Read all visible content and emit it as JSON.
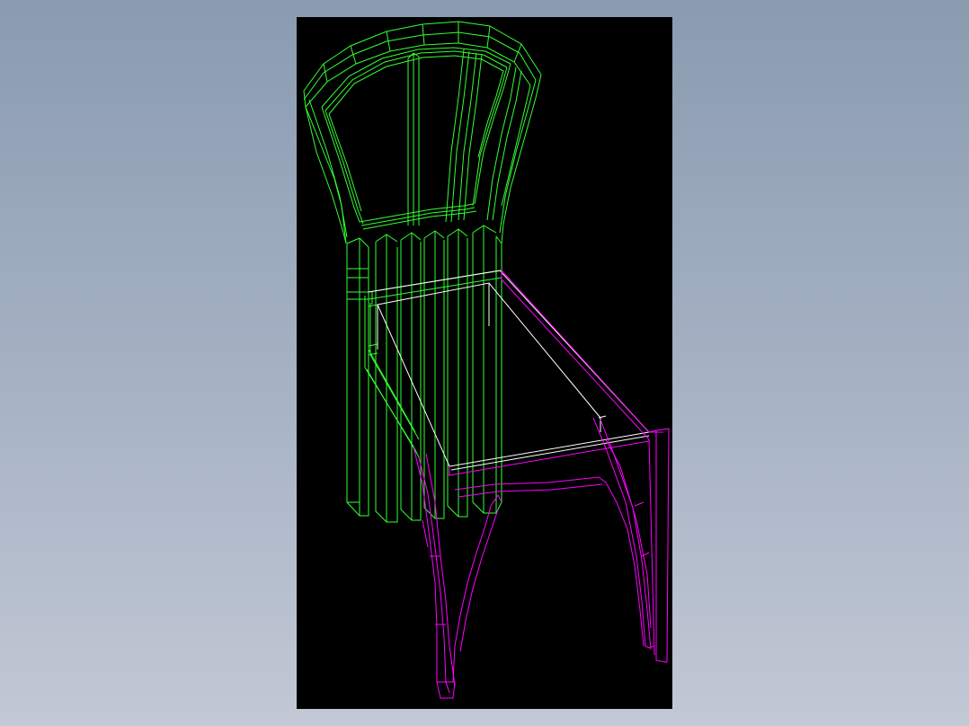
{
  "viewport": {
    "background": "#000000",
    "page_background_top": "#8a9bb0",
    "page_background_bottom": "#c2c8d5"
  },
  "model": {
    "object": "chair-wireframe",
    "colors": {
      "backrest": "#33ff33",
      "legs_frame": "#ff00ff",
      "seat_edge": "#ffffff"
    }
  }
}
